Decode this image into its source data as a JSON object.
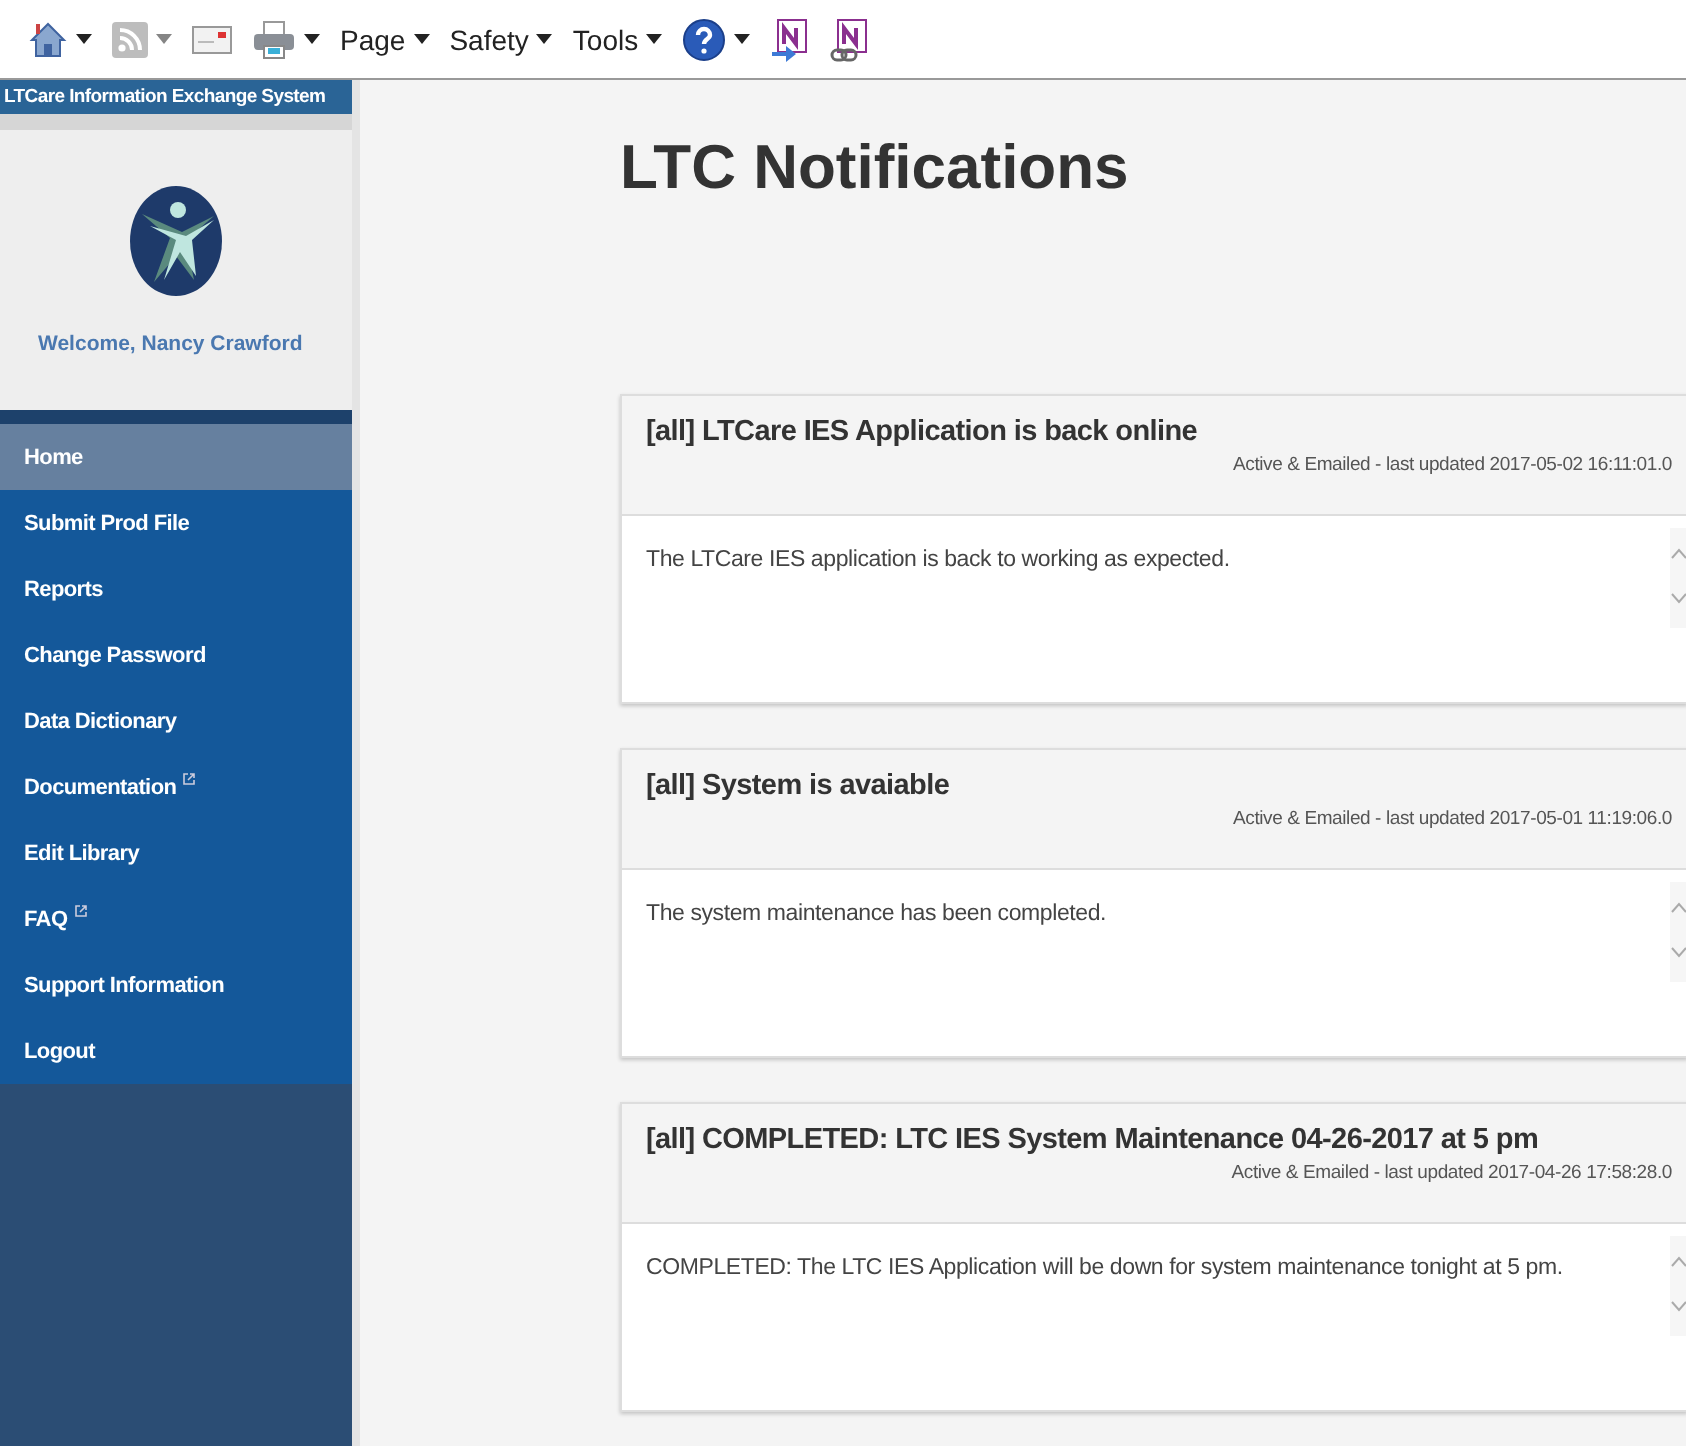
{
  "toolbar": {
    "items": [
      {
        "kind": "home",
        "caret": true,
        "disabled": false
      },
      {
        "kind": "feed",
        "caret": true,
        "disabled": true
      },
      {
        "kind": "mail",
        "caret": false,
        "disabled": false
      },
      {
        "kind": "printer",
        "caret": true,
        "disabled": false
      },
      {
        "kind": "menu",
        "label": "Page",
        "caret": true,
        "disabled": false
      },
      {
        "kind": "menu",
        "label": "Safety",
        "caret": true,
        "disabled": false
      },
      {
        "kind": "menu",
        "label": "Tools",
        "caret": true,
        "disabled": false
      },
      {
        "kind": "help",
        "caret": true,
        "disabled": false
      },
      {
        "kind": "note",
        "caret": false,
        "disabled": false
      },
      {
        "kind": "note-link",
        "caret": false,
        "disabled": false
      }
    ]
  },
  "sidebar": {
    "app_title": "LTCare Information Exchange System",
    "welcome": "Welcome, Nancy Crawford",
    "items": [
      {
        "label": "Home",
        "selected": true,
        "external": false
      },
      {
        "label": "Submit Prod File",
        "selected": false,
        "external": false
      },
      {
        "label": "Reports",
        "selected": false,
        "external": false
      },
      {
        "label": "Change Password",
        "selected": false,
        "external": false
      },
      {
        "label": "Data Dictionary",
        "selected": false,
        "external": false
      },
      {
        "label": "Documentation",
        "selected": false,
        "external": true
      },
      {
        "label": "Edit Library",
        "selected": false,
        "external": false
      },
      {
        "label": "FAQ",
        "selected": false,
        "external": true
      },
      {
        "label": "Support Information",
        "selected": false,
        "external": false
      },
      {
        "label": "Logout",
        "selected": false,
        "external": false
      }
    ]
  },
  "page": {
    "title": "LTC Notifications"
  },
  "notifications": [
    {
      "title": "[all] LTCare IES Application is back online",
      "meta": "Active & Emailed - last updated 2017-05-02 16:11:01.0",
      "body": "The LTCare IES application is back to working as expected."
    },
    {
      "title": "[all] System is avaiable",
      "meta": "Active & Emailed - last updated 2017-05-01 11:19:06.0",
      "body": "The system maintenance has been completed."
    },
    {
      "title": "[all] COMPLETED: LTC IES System Maintenance 04-26-2017 at 5 pm",
      "meta": "Active & Emailed - last updated 2017-04-26 17:58:28.0",
      "body": "COMPLETED: The LTC IES Application will be down for system maintenance tonight at 5 pm."
    }
  ]
}
